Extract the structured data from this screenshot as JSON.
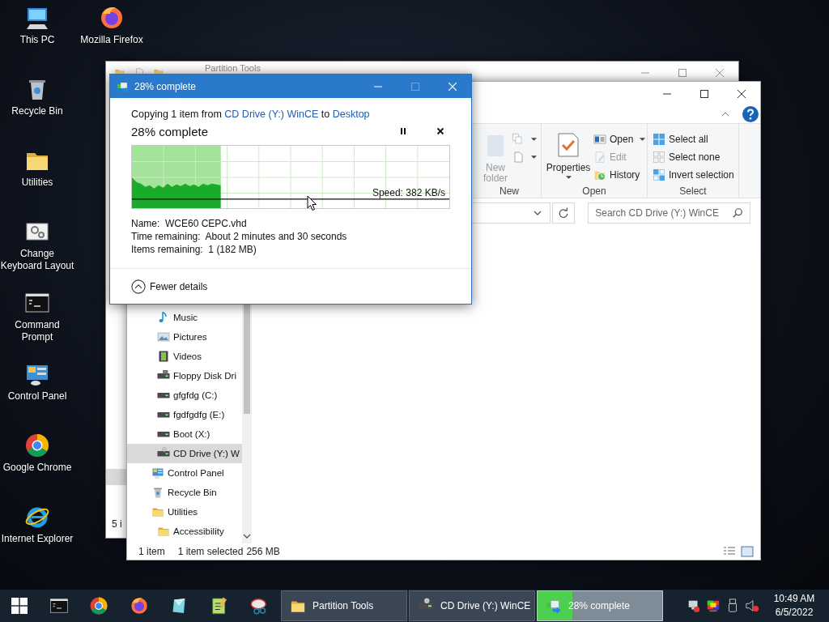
{
  "desktop_icons": [
    {
      "label": "This PC",
      "kind": "pc"
    },
    {
      "label": "Recycle Bin",
      "kind": "recycle"
    },
    {
      "label": "Utilities",
      "kind": "folder"
    },
    {
      "label": "Change Keyboard Layout",
      "kind": "gears"
    },
    {
      "label": "Command Prompt",
      "kind": "terminal"
    },
    {
      "label": "Control Panel",
      "kind": "control"
    },
    {
      "label": "Google Chrome",
      "kind": "chrome"
    },
    {
      "label": "Internet Explorer",
      "kind": "ie"
    },
    {
      "label": "Mozilla Firefox",
      "kind": "firefox"
    }
  ],
  "back_window": {
    "title": "Partition Tools",
    "status": "5 i"
  },
  "explorer": {
    "ribbon": [
      {
        "label": "New",
        "items": [
          {
            "kind": "large",
            "label": "New folder",
            "disabled": true,
            "menu": false
          },
          {
            "kind": "icon",
            "menu": true
          },
          {
            "kind": "icon",
            "menu": true
          }
        ]
      },
      {
        "label": "Open",
        "items": [
          {
            "kind": "large",
            "label": "Properties",
            "disabled": false,
            "menu": true
          },
          {
            "kind": "small",
            "label": "Open",
            "disabled": false,
            "menu": true
          },
          {
            "kind": "small",
            "label": "Edit",
            "disabled": true,
            "menu": false
          },
          {
            "kind": "small",
            "label": "History",
            "disabled": false,
            "menu": false
          }
        ]
      },
      {
        "label": "Select",
        "items": [
          {
            "kind": "small",
            "label": "Select all",
            "disabled": false,
            "menu": false
          },
          {
            "kind": "small",
            "label": "Select none",
            "disabled": false,
            "menu": false
          },
          {
            "kind": "small",
            "label": "Invert selection",
            "disabled": false,
            "menu": false
          }
        ]
      }
    ],
    "search": {
      "placeholder": "Search CD Drive (Y:) WinCE"
    },
    "nav": [
      {
        "children": [
          {
            "label": "Music",
            "kind": "music",
            "selected": false
          },
          {
            "label": "Pictures",
            "kind": "pictures",
            "selected": false
          },
          {
            "label": "Videos",
            "kind": "videos",
            "selected": false
          },
          {
            "label": "Floppy Disk Dri",
            "kind": "floppy",
            "selected": false
          },
          {
            "label": "gfgfdg (C:)",
            "kind": "drive",
            "selected": false
          },
          {
            "label": "fgdfgdfg (E:)",
            "kind": "drive",
            "selected": false
          },
          {
            "label": "Boot (X:)",
            "kind": "drive",
            "selected": false
          },
          {
            "label": "CD Drive (Y:) W",
            "kind": "cd",
            "selected": true
          }
        ]
      },
      {
        "label": "Control Panel",
        "kind": "control",
        "selected": false
      },
      {
        "label": "Recycle Bin",
        "kind": "recycle",
        "selected": false
      },
      {
        "label": "Utilities",
        "kind": "folder",
        "selected": false,
        "children": [
          {
            "label": "Accessibility",
            "kind": "folder",
            "selected": false
          }
        ]
      }
    ],
    "status": {
      "count": "1 item",
      "selection": "1 item selected",
      "size": "256 MB"
    }
  },
  "copy_dialog": {
    "title": "28% complete",
    "summary": {
      "prefix": "Copying 1 item from",
      "source": "CD Drive (Y:) WinCE",
      "joiner": "to",
      "destination": "Desktop"
    },
    "heading": "28% complete",
    "level": 0.28,
    "speed": "Speed: 382 KB/s",
    "details": [
      {
        "label": "Name:",
        "value": "WCE60 CEPC.vhd"
      },
      {
        "label": "Time remaining:",
        "value": "About 2 minutes and 30 seconds"
      },
      {
        "label": "Items remaining:",
        "value": "1 (182 MB)"
      }
    ],
    "toggle": "Fewer details"
  },
  "taskbar": {
    "tasks": [
      {
        "label": "Partition Tools",
        "kind": "folder",
        "selected": false
      },
      {
        "label": "CD Drive (Y:) WinCE",
        "kind": "cd",
        "selected": false
      },
      {
        "label": "28% complete",
        "kind": "copy",
        "selected": true,
        "level": 0.28
      }
    ],
    "clock": {
      "time": "10:49 AM",
      "date": "6/5/2022"
    }
  }
}
